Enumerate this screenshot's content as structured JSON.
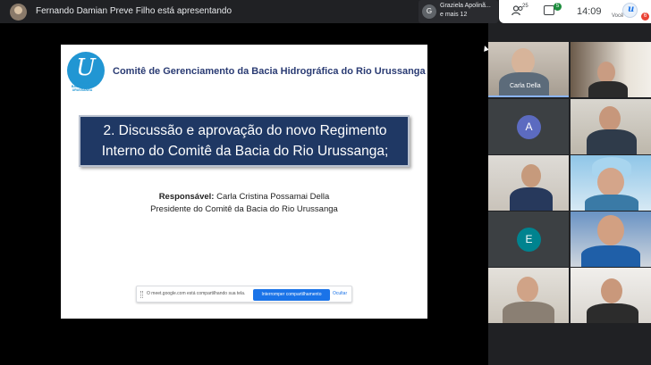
{
  "presenter": {
    "text": "Fernando Damian Preve Filho está apresentando"
  },
  "notification": {
    "avatar_letter": "G",
    "line1": "Graziela Apolinã...",
    "line2": "e mais 12"
  },
  "controls": {
    "people_count": "25",
    "chat_badge": "5",
    "time": "14:09",
    "self_label": "Você",
    "self_badge": "6"
  },
  "slide": {
    "header": "Comitê de Gerenciamento da Bacia Hidrográfica do Rio Urussanga",
    "logo_letter": "U",
    "logo_caption": "COMITÊ DA BACIA DO RIO URUSSANGA",
    "title_line1": "2. Discussão e aprovação do novo Regimento",
    "title_line2": "Interno do Comitê da Bacia do Rio Urussanga;",
    "responsible_label": "Responsável:",
    "responsible_name": " Carla Cristina Possamai Della",
    "responsible_role": "Presidente do Comitê da Bacia do Rio Urussanga"
  },
  "share_bar": {
    "message": "O meet.google.com está compartilhando sua tela.",
    "stop_label": "Interromper compartilhamento",
    "hide_label": "Ocultar"
  },
  "participants": [
    {
      "type": "video",
      "name": "Carla Della"
    },
    {
      "type": "video",
      "name": ""
    },
    {
      "type": "avatar",
      "letter": "A",
      "color": "#5c6bc0"
    },
    {
      "type": "video",
      "name": ""
    },
    {
      "type": "video",
      "name": ""
    },
    {
      "type": "video",
      "name": ""
    },
    {
      "type": "avatar",
      "letter": "E",
      "color": "#00838f"
    },
    {
      "type": "video",
      "name": ""
    },
    {
      "type": "video",
      "name": ""
    },
    {
      "type": "video",
      "name": ""
    }
  ]
}
